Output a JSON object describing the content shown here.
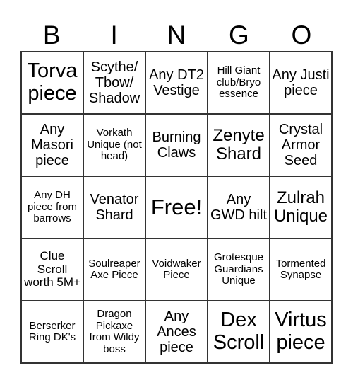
{
  "header": {
    "letters": [
      "B",
      "I",
      "N",
      "G",
      "O"
    ]
  },
  "cells": [
    "Torva piece",
    "Scythe/ Tbow/ Shadow",
    "Any DT2 Vestige",
    "Hill Giant club/Bryo essence",
    "Any Justi piece",
    "Any Masori piece",
    "Vorkath Unique (not head)",
    "Burning Claws",
    "Zenyte Shard",
    "Crystal Armor Seed",
    "Any DH piece from barrows",
    "Venator Shard",
    "Free!",
    "Any GWD hilt",
    "Zulrah Unique",
    "Clue Scroll worth 5M+",
    "Soulreaper Axe Piece",
    "Voidwaker Piece",
    "Grotesque Guardians Unique",
    "Tormented Synapse",
    "Berserker Ring DK's",
    "Dragon Pickaxe from Wildy boss",
    "Any Ances piece",
    "Dex Scroll",
    "Virtus piece"
  ]
}
